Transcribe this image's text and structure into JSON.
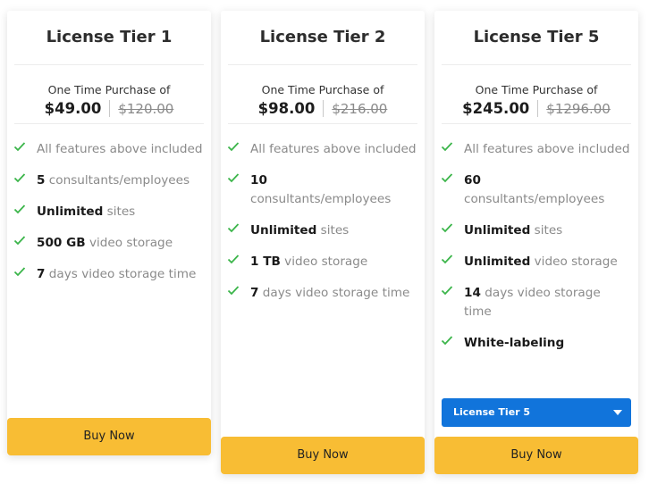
{
  "cards": [
    {
      "title": "License Tier 1",
      "price_label": "One Time Purchase of",
      "price_now": "$49.00",
      "price_old": "$120.00",
      "features": [
        {
          "strong": "",
          "text": "All features above included"
        },
        {
          "strong": "5",
          "text": " consultants/employees"
        },
        {
          "strong": "Unlimited",
          "text": " sites"
        },
        {
          "strong": "500 GB",
          "text": " video storage"
        },
        {
          "strong": "7",
          "text": " days video storage time"
        }
      ],
      "buy_label": "Buy Now"
    },
    {
      "title": "License Tier 2",
      "price_label": "One Time Purchase of",
      "price_now": "$98.00",
      "price_old": "$216.00",
      "features": [
        {
          "strong": "",
          "text": "All features above included"
        },
        {
          "strong": "10",
          "text": " consultants/employees"
        },
        {
          "strong": "Unlimited",
          "text": " sites"
        },
        {
          "strong": "1 TB",
          "text": " video storage"
        },
        {
          "strong": "7",
          "text": " days video storage time"
        }
      ],
      "buy_label": "Buy Now"
    },
    {
      "title": "License Tier 5",
      "price_label": "One Time Purchase of",
      "price_now": "$245.00",
      "price_old": "$1296.00",
      "features": [
        {
          "strong": "",
          "text": "All features above included"
        },
        {
          "strong": "60",
          "text": " consultants/employees"
        },
        {
          "strong": "Unlimited",
          "text": " sites"
        },
        {
          "strong": "Unlimited",
          "text": " video storage"
        },
        {
          "strong": "14",
          "text": " days video storage time"
        },
        {
          "strong": "White-labeling",
          "text": ""
        }
      ],
      "tier_select": {
        "selected": "License Tier 5"
      },
      "buy_label": "Buy Now"
    }
  ],
  "icons": {
    "feature": "check-icon",
    "select": "caret-down-icon"
  },
  "colors": {
    "accent_button": "#f8bd34",
    "select_bg": "#1174db",
    "check": "#3bb54a"
  }
}
